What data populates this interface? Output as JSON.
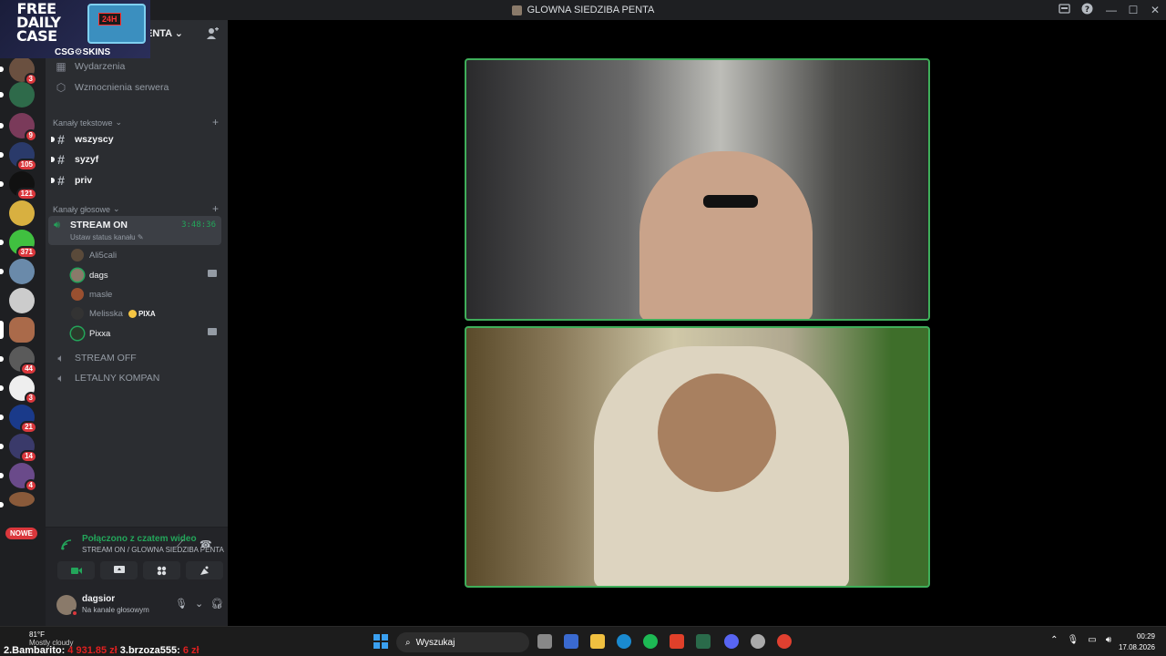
{
  "window": {
    "title": "GLOWNA SIEDZIBA PENTA"
  },
  "ad": {
    "headline": "FREE DAILY CASE",
    "crate_tag": "24H",
    "brand": "CSG⚙SKINS"
  },
  "server": {
    "name_visible": "ENTA"
  },
  "rail": {
    "badges": [
      "3",
      "9",
      "105",
      "121",
      "371",
      "44",
      "3",
      "21",
      "14",
      "4"
    ],
    "new_label": "NOWE"
  },
  "sidebar": {
    "top_items": [
      {
        "label": "Wydarzenia",
        "icon": "calendar-icon"
      },
      {
        "label": "Wzmocnienia serwera",
        "icon": "boost-icon"
      }
    ],
    "text_category": "Kanały tekstowe",
    "text_channels": [
      {
        "label": "wszyscy"
      },
      {
        "label": "syzyf"
      },
      {
        "label": "priv"
      }
    ],
    "voice_category": "Kanały głosowe",
    "active_voice": {
      "name": "STREAM ON",
      "timer": "3:48:36",
      "status_hint": "Ustaw status kanału"
    },
    "voice_users": [
      {
        "name": "Ali5cali"
      },
      {
        "name": "dags"
      },
      {
        "name": "masle"
      },
      {
        "name": "Melisska",
        "tag": "PIXA"
      },
      {
        "name": "Pixxa"
      }
    ],
    "other_voice": [
      {
        "label": "STREAM OFF"
      },
      {
        "label": "LETALNY KOMPAN"
      }
    ]
  },
  "voice_panel": {
    "status": "Połączono z czatem wideo",
    "location": "STREAM ON / GLOWNA SIEDZIBA PENTA"
  },
  "user_panel": {
    "username": "dagsior",
    "status": "Na kanale głosowym"
  },
  "taskbar": {
    "weather_temp": "81°F",
    "weather_cond": "Mostly cloudy",
    "ticker_a": "2.Bambarito: ",
    "ticker_a_val": "4 931.85 zł",
    "ticker_b": " 3.brzoza555: ",
    "ticker_b_val": "6 zł",
    "search_placeholder": "Wyszukaj",
    "time": "00:29",
    "date": "17.08.2026"
  },
  "colors": {
    "accent_green": "#23a55a",
    "tile_border": "#3fae5a",
    "badge_red": "#da373c"
  }
}
